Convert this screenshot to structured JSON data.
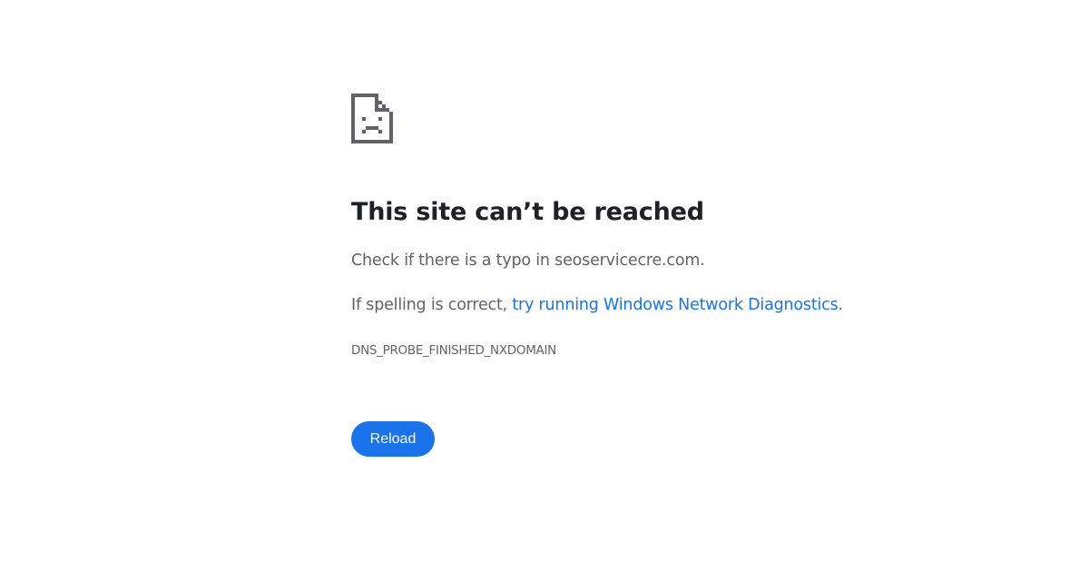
{
  "error": {
    "icon": "sad-page-icon",
    "title": "This site can’t be reached",
    "line1": "Check if there is a typo in seoservicecre.com.",
    "line2_prefix": "If spelling is correct, ",
    "line2_link": "try running Windows Network Diagnostics",
    "line2_suffix": ".",
    "code": "DNS_PROBE_FINISHED_NXDOMAIN"
  },
  "buttons": {
    "reload_label": "Reload"
  },
  "colors": {
    "title": "#202124",
    "text": "#5f6368",
    "link": "#1a73e8",
    "button_bg": "#1a73e8",
    "button_text": "#ffffff",
    "icon": "#5f6368"
  }
}
